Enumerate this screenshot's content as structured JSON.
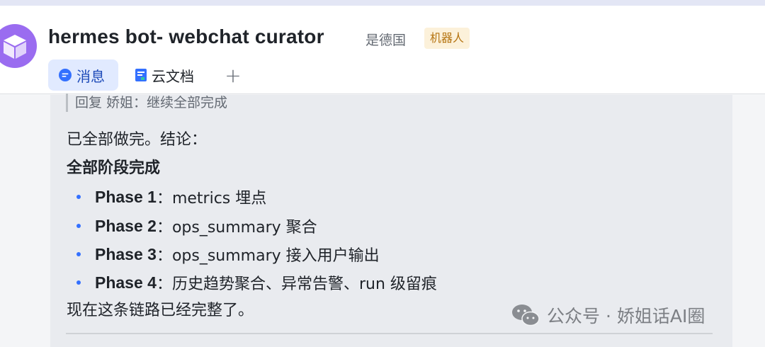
{
  "header": {
    "title": "hermes bot- webchat curator",
    "owner": "是德国",
    "badge": "机器人",
    "tabs": [
      {
        "label": "消息",
        "icon": "chat-bubble-icon"
      },
      {
        "label": "云文档",
        "icon": "cloud-doc-icon"
      }
    ],
    "add_tab_label": "+"
  },
  "message": {
    "quote": "回复 娇姐：继续全部完成",
    "intro": "已全部做完。结论：",
    "heading": "全部阶段完成",
    "phases": [
      {
        "name": "Phase 1",
        "desc": "：metrics 埋点"
      },
      {
        "name": "Phase 2",
        "desc": "：ops_summary 聚合"
      },
      {
        "name": "Phase 3",
        "desc": "：ops_summary 接入用户输出"
      },
      {
        "name": "Phase 4",
        "desc": "：历史趋势聚合、异常告警、run 级留痕"
      }
    ],
    "closing": "现在这条链路已经完整了。"
  },
  "watermark": {
    "text": "公众号 · 娇姐话AI圈",
    "icon": "wechat-icon"
  },
  "colors": {
    "accent": "#3370ff",
    "tab_active_bg": "#e1eaff",
    "badge_bg": "#fcf1da",
    "badge_text": "#b57411",
    "avatar": "#9a6cf0"
  }
}
